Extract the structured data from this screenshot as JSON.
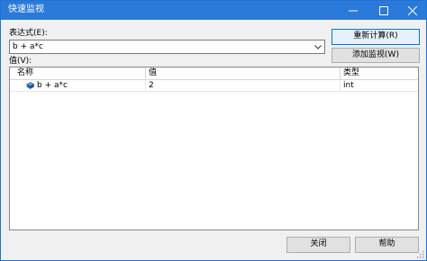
{
  "window": {
    "title": "快速监视"
  },
  "expression": {
    "label": "表达式(E):",
    "value": "b + a*c"
  },
  "buttons": {
    "recalculate": "重新计算(R)",
    "add_watch": "添加监视(W)",
    "close": "关闭",
    "help": "帮助"
  },
  "values": {
    "label": "值(V):",
    "columns": [
      "名称",
      "值",
      "类型"
    ],
    "rows": [
      {
        "name": "b + a*c",
        "value": "2",
        "type": "int"
      }
    ]
  },
  "icons": {
    "minimize": "minimize-icon",
    "maximize": "maximize-icon",
    "close": "close-icon",
    "dropdown": "chevron-down-icon",
    "row": "variable-icon",
    "grip": "size-grip-icon"
  },
  "colors": {
    "titlebar": "#2b79d8",
    "focus_border": "#0078d7",
    "button_face": "#e1e1e1"
  }
}
